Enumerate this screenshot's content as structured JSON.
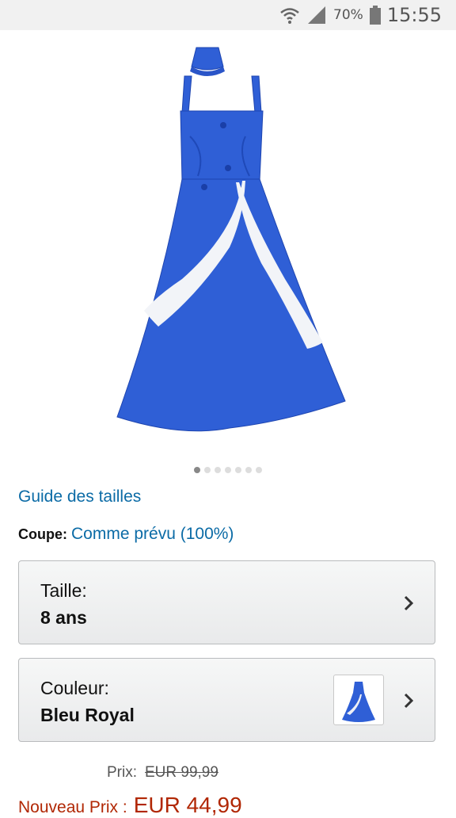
{
  "status_bar": {
    "battery_percent": "70%",
    "time": "15:55",
    "icons": [
      "wifi-icon",
      "signal-icon",
      "battery-icon"
    ]
  },
  "gallery": {
    "image_name": "blue-dress-image",
    "dot_count": 7,
    "active_dot": 0
  },
  "size_guide": {
    "label": "Guide des tailles"
  },
  "fit": {
    "label": "Coupe:",
    "value": "Comme prévu (100%)"
  },
  "size_selector": {
    "label": "Taille:",
    "value": "8 ans"
  },
  "color_selector": {
    "label": "Couleur:",
    "value": "Bleu Royal"
  },
  "price": {
    "label": "Prix:",
    "old_value": "EUR 99,99",
    "new_label": "Nouveau Prix :",
    "new_value": "EUR 44,99"
  },
  "colors": {
    "link": "#0b6ba6",
    "sale_price": "#b12704",
    "dress": "#2f5fd6"
  }
}
